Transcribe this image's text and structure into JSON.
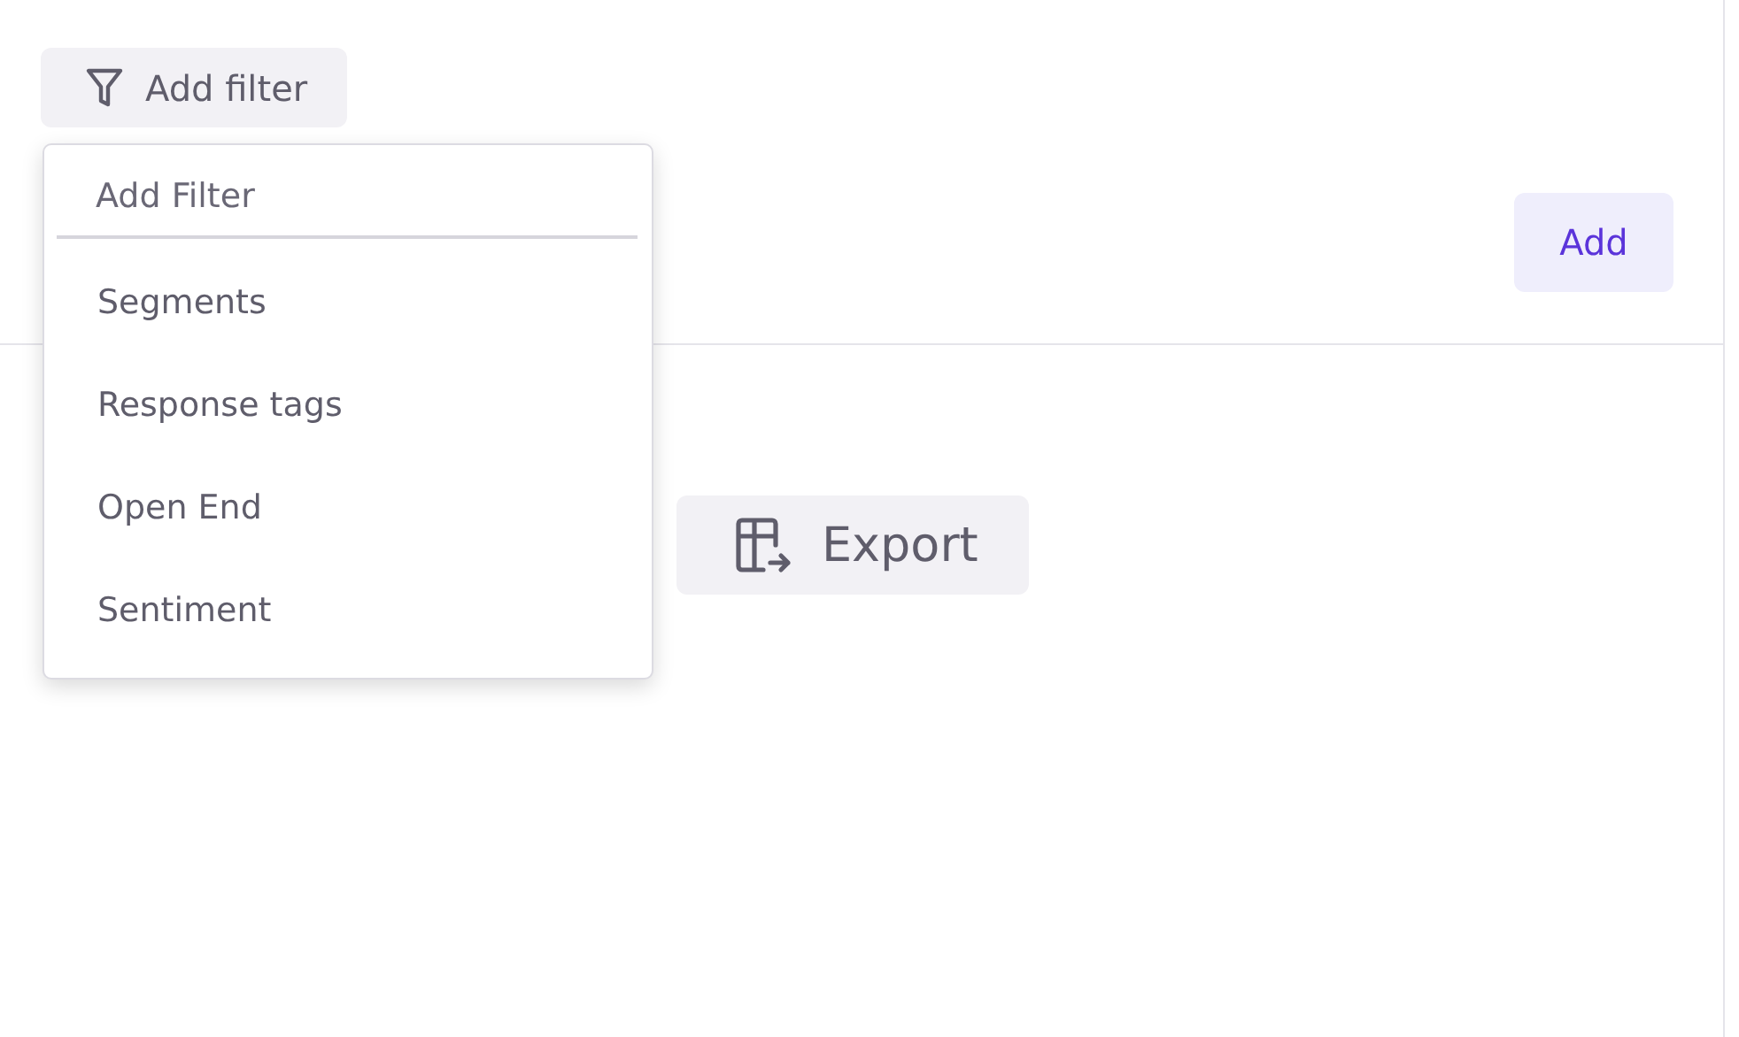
{
  "filter_button": {
    "label": "Add filter"
  },
  "add_button": {
    "label": "Add"
  },
  "export_button": {
    "label": "Export"
  },
  "filter_menu": {
    "search": {
      "placeholder": "Add Filter"
    },
    "items": [
      {
        "label": "Segments"
      },
      {
        "label": "Response tags"
      },
      {
        "label": "Open End"
      },
      {
        "label": "Sentiment"
      }
    ]
  }
}
